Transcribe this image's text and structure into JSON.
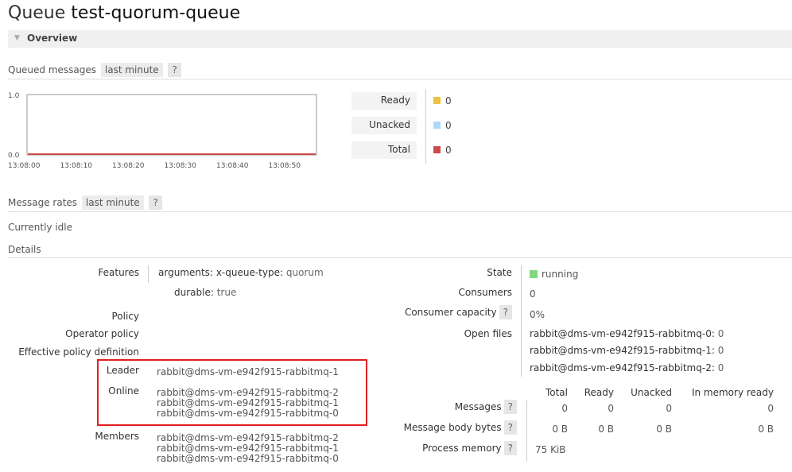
{
  "header": {
    "title_prefix": "Queue",
    "queue_name": "test-quorum-queue"
  },
  "overview": {
    "label": "Overview"
  },
  "queued_messages": {
    "label": "Queued messages",
    "range": "last minute",
    "help": "?",
    "chart": {
      "y_max": "1.0",
      "y_min": "0.0",
      "x_ticks": [
        "13:08:00",
        "13:08:10",
        "13:08:20",
        "13:08:30",
        "13:08:40",
        "13:08:50"
      ]
    },
    "legend": [
      {
        "label": "Ready",
        "value": "0",
        "color": "#edc240"
      },
      {
        "label": "Unacked",
        "value": "0",
        "color": "#afd8f8"
      },
      {
        "label": "Total",
        "value": "0",
        "color": "#cb4b4b"
      }
    ]
  },
  "chart_data": {
    "type": "line",
    "x": [
      "13:08:00",
      "13:08:10",
      "13:08:20",
      "13:08:30",
      "13:08:40",
      "13:08:50"
    ],
    "ylim": [
      0.0,
      1.0
    ],
    "series": [
      {
        "name": "Ready",
        "values": [
          0,
          0,
          0,
          0,
          0,
          0
        ]
      },
      {
        "name": "Unacked",
        "values": [
          0,
          0,
          0,
          0,
          0,
          0
        ]
      },
      {
        "name": "Total",
        "values": [
          0,
          0,
          0,
          0,
          0,
          0
        ]
      }
    ]
  },
  "message_rates": {
    "label": "Message rates",
    "range": "last minute",
    "help": "?"
  },
  "idle_text": "Currently idle",
  "details": {
    "label": "Details",
    "features_label": "Features",
    "arguments_key": "arguments:",
    "queue_type_key": "x-queue-type:",
    "queue_type_value": "quorum",
    "durable_key": "durable:",
    "durable_value": "true",
    "policy_label": "Policy",
    "operator_policy_label": "Operator policy",
    "effective_policy_label": "Effective policy definition",
    "leader_label": "Leader",
    "leader_value": "rabbit@dms-vm-e942f915-rabbitmq-1",
    "online_label": "Online",
    "online_nodes": [
      "rabbit@dms-vm-e942f915-rabbitmq-2",
      "rabbit@dms-vm-e942f915-rabbitmq-1",
      "rabbit@dms-vm-e942f915-rabbitmq-0"
    ],
    "members_label": "Members",
    "member_nodes": [
      "rabbit@dms-vm-e942f915-rabbitmq-2",
      "rabbit@dms-vm-e942f915-rabbitmq-1",
      "rabbit@dms-vm-e942f915-rabbitmq-0"
    ],
    "state_label": "State",
    "state_value": "running",
    "state_color": "#7ed87e",
    "consumers_label": "Consumers",
    "consumers_value": "0",
    "consumer_capacity_label": "Consumer capacity",
    "consumer_capacity_value": "0%",
    "open_files_label": "Open files",
    "open_files": [
      {
        "node": "rabbit@dms-vm-e942f915-rabbitmq-0:",
        "count": "0"
      },
      {
        "node": "rabbit@dms-vm-e942f915-rabbitmq-1:",
        "count": "0"
      },
      {
        "node": "rabbit@dms-vm-e942f915-rabbitmq-2:",
        "count": "0"
      }
    ],
    "stats_headers": [
      "Total",
      "Ready",
      "Unacked",
      "In memory ready"
    ],
    "messages_label": "Messages",
    "messages_values": [
      "0",
      "0",
      "0",
      "0"
    ],
    "body_bytes_label": "Message body bytes",
    "body_bytes_values": [
      "0 B",
      "0 B",
      "0 B",
      "0 B"
    ],
    "process_memory_label": "Process memory",
    "process_memory_value": "75 KiB",
    "help": "?"
  }
}
